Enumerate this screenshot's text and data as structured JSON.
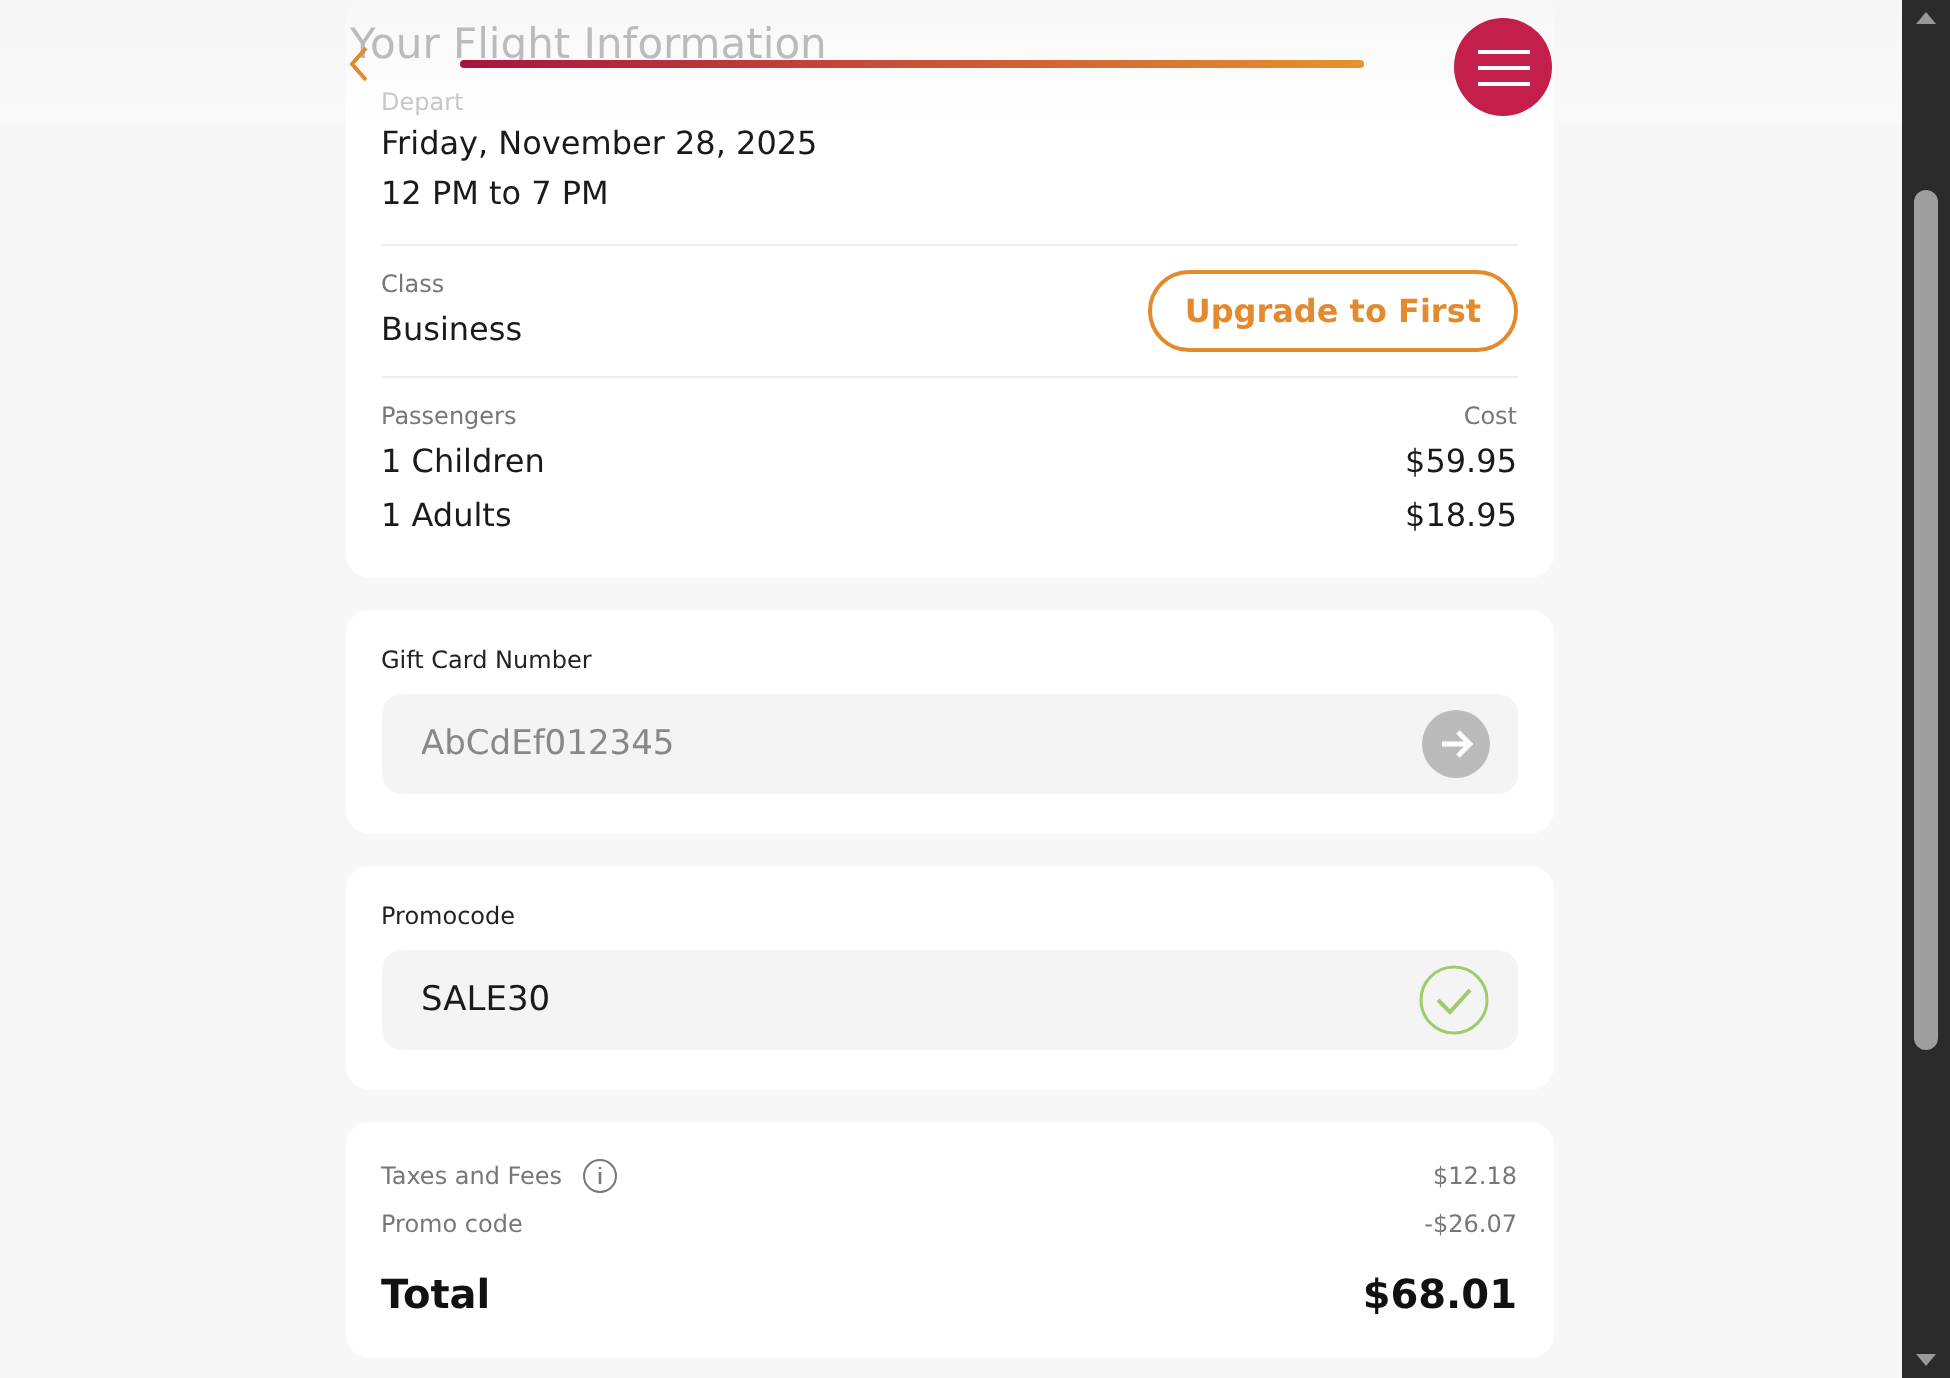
{
  "header": {
    "title": "Your Flight Information"
  },
  "flight": {
    "depart_label": "Depart",
    "date": "Friday, November 28, 2025",
    "time": "12 PM to 7 PM",
    "class_label": "Class",
    "class_value": "Business",
    "upgrade_button": "Upgrade to First",
    "passengers_label": "Passengers",
    "cost_label": "Cost",
    "passengers": [
      {
        "label": "1 Children",
        "cost": "$59.95"
      },
      {
        "label": "1 Adults",
        "cost": "$18.95"
      }
    ]
  },
  "gift_card": {
    "label": "Gift Card Number",
    "placeholder": "AbCdEf012345"
  },
  "promocode": {
    "label": "Promocode",
    "value": "SALE30",
    "valid": true
  },
  "summary": {
    "lines": [
      {
        "label": "Taxes and Fees",
        "value": "$12.18",
        "info": true
      },
      {
        "label": "Promo code",
        "value": "-$26.07",
        "info": false
      }
    ],
    "total_label": "Total",
    "total_value": "$68.01"
  }
}
